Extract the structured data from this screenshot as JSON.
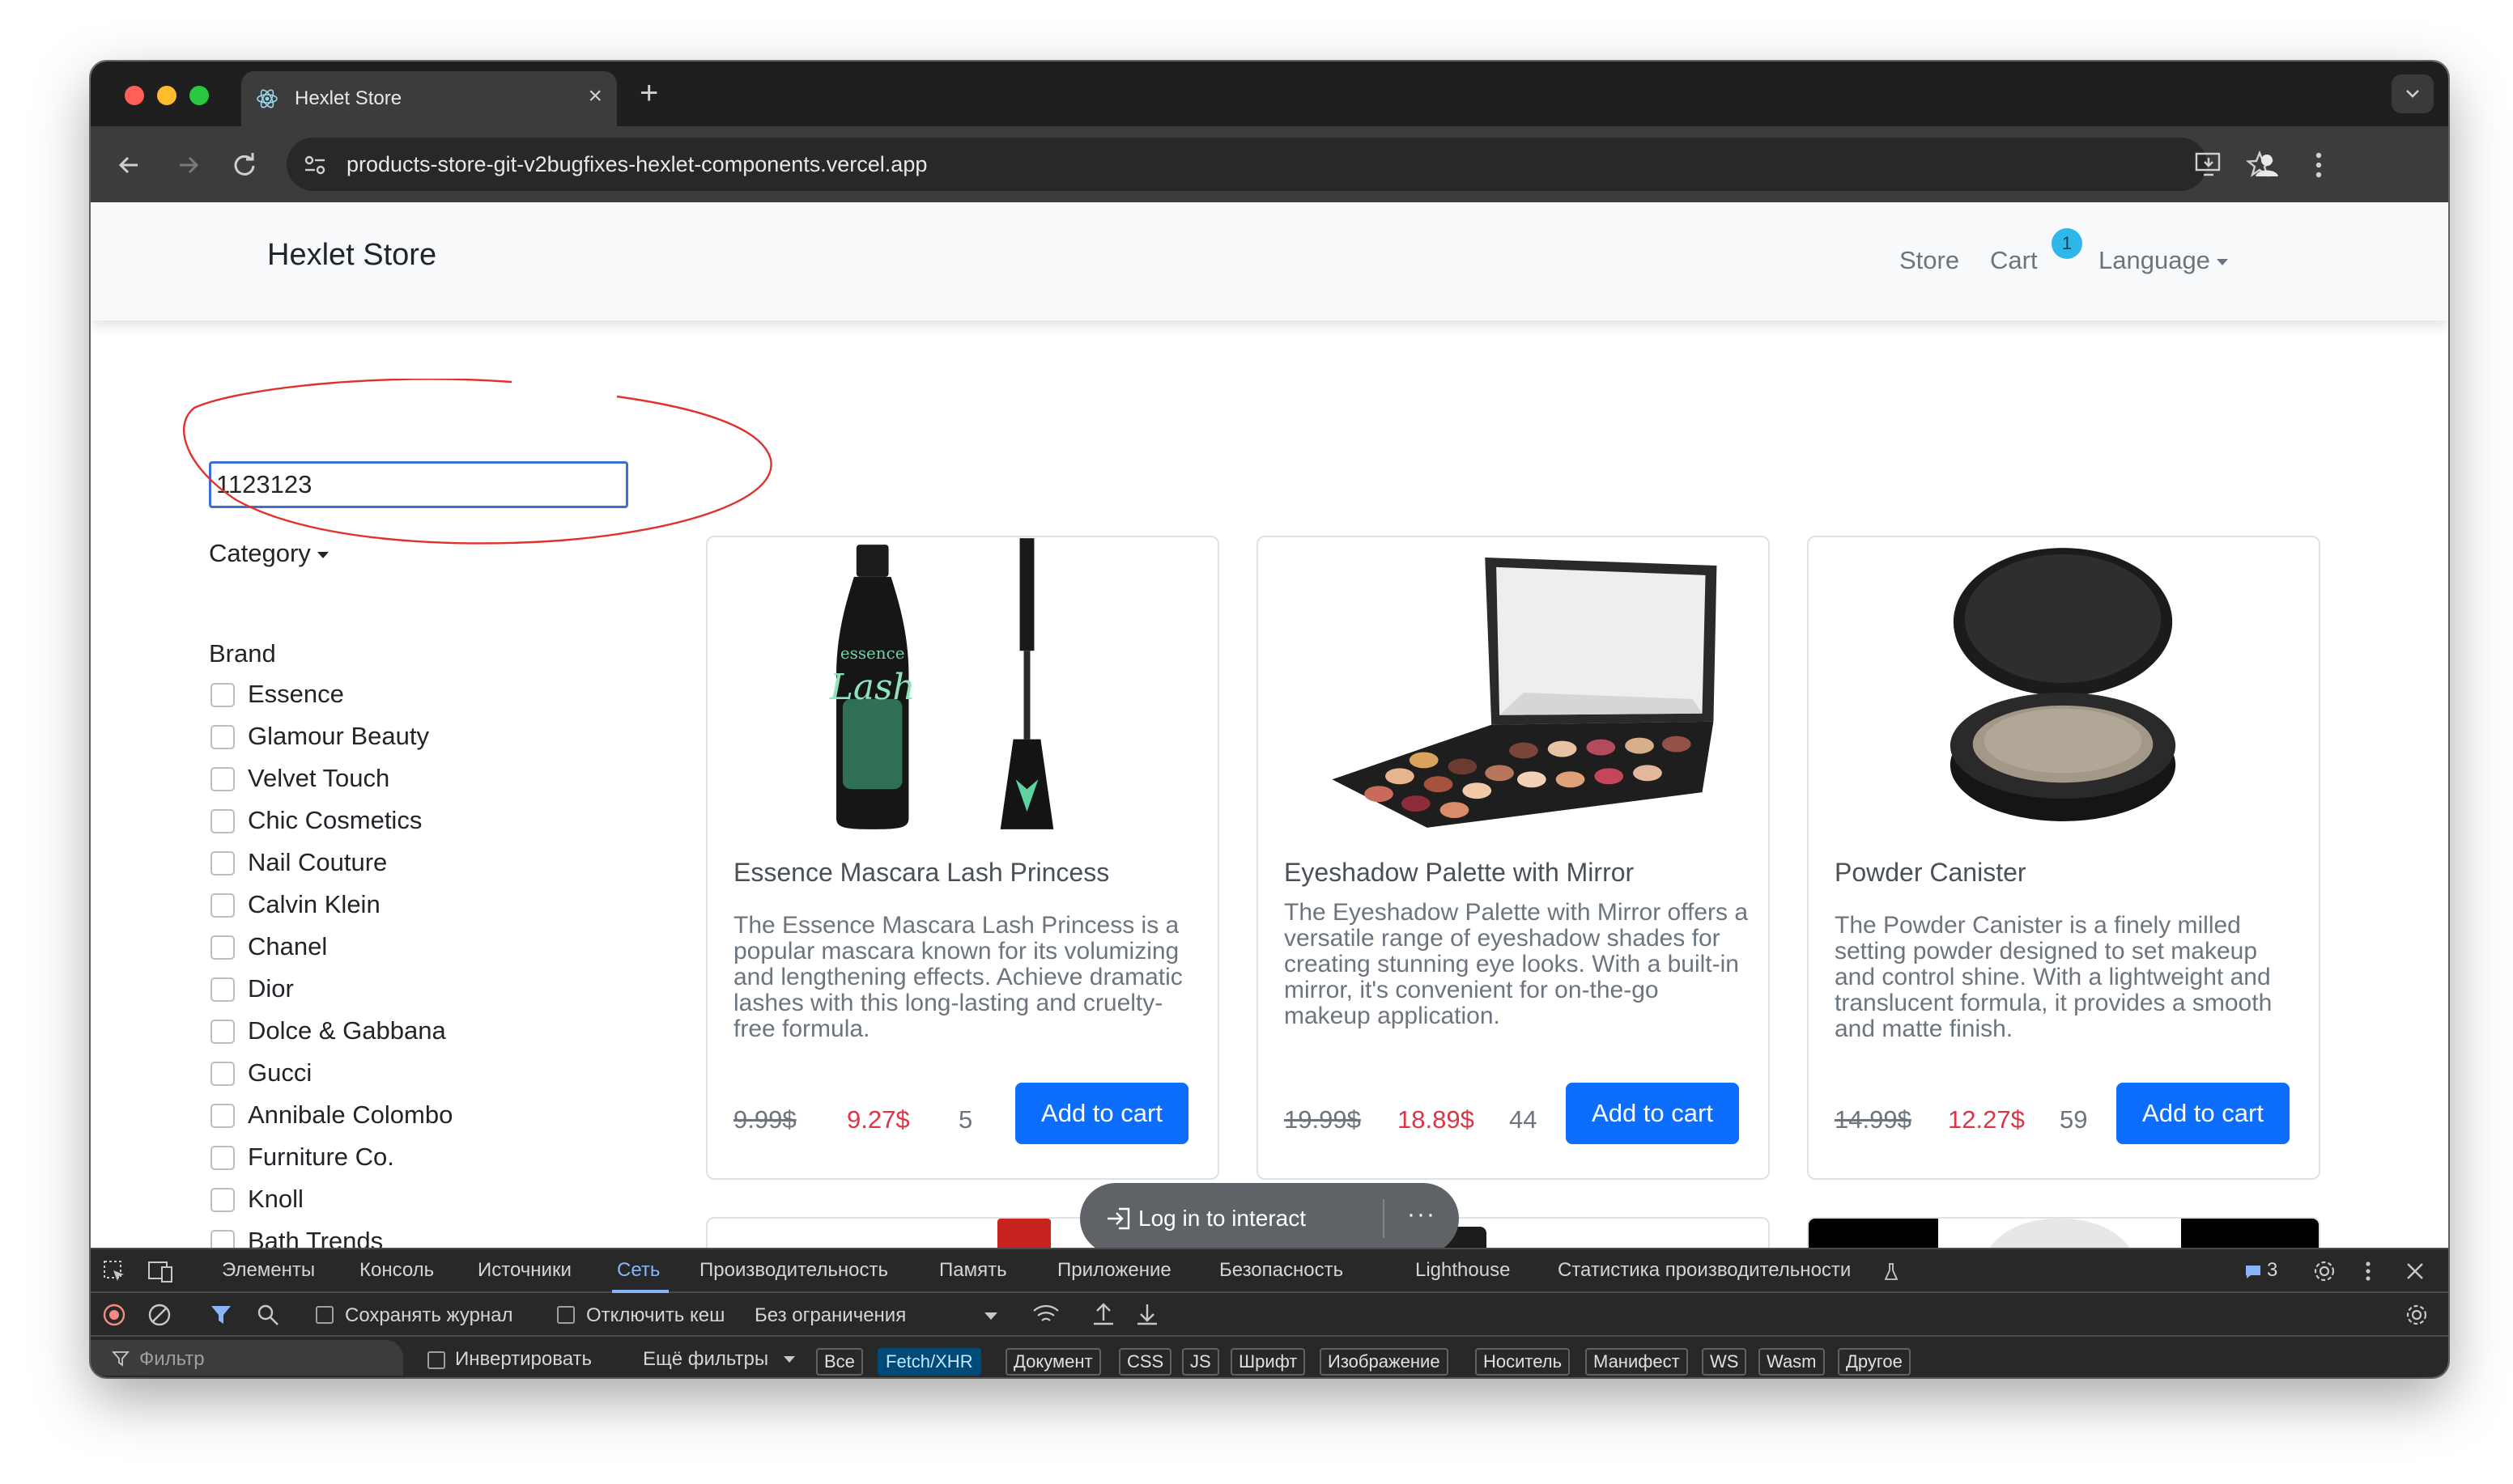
{
  "browser": {
    "tab_title": "Hexlet Store",
    "tab_close": "×",
    "new_tab": "+",
    "url": "products-store-git-v2bugfixes-hexlet-components.vercel.app"
  },
  "navbar": {
    "brand": "Hexlet Store",
    "store_link": "Store",
    "cart_link": "Cart",
    "cart_count": "1",
    "language_link": "Language"
  },
  "search": {
    "value": "1123123"
  },
  "filters": {
    "category_label": "Category",
    "brand_heading": "Brand",
    "brands": [
      "Essence",
      "Glamour Beauty",
      "Velvet Touch",
      "Chic Cosmetics",
      "Nail Couture",
      "Calvin Klein",
      "Chanel",
      "Dior",
      "Dolce & Gabbana",
      "Gucci",
      "Annibale Colombo",
      "Furniture Co.",
      "Knoll",
      "Bath Trends",
      ""
    ]
  },
  "products": [
    {
      "title": "Essence Mascara Lash Princess",
      "description": "The Essence Mascara Lash Princess is a popular mascara known for its volumizing and lengthening effects. Achieve dramatic lashes with this long-lasting and cruelty-free formula.",
      "old_price": "9.99$",
      "price": "9.27$",
      "stock": "5",
      "button": "Add to cart"
    },
    {
      "title": "Eyeshadow Palette with Mirror",
      "description": "The Eyeshadow Palette with Mirror offers a versatile range of eyeshadow shades for creating stunning eye looks. With a built-in mirror, it's convenient for on-the-go makeup application.",
      "old_price": "19.99$",
      "price": "18.89$",
      "stock": "44",
      "button": "Add to cart"
    },
    {
      "title": "Powder Canister",
      "description": "The Powder Canister is a finely milled setting powder designed to set makeup and control shine. With a lightweight and translucent formula, it provides a smooth and matte finish.",
      "old_price": "14.99$",
      "price": "12.27$",
      "stock": "59",
      "button": "Add to cart"
    }
  ],
  "overlay": {
    "login_text": "Log in to interact",
    "more": "···"
  },
  "devtools": {
    "tabs": [
      "Элементы",
      "Консоль",
      "Источники",
      "Сеть",
      "Производительность",
      "Память",
      "Приложение",
      "Безопасность",
      "Lighthouse",
      "Статистика производительности"
    ],
    "active_tab": "Сеть",
    "issues_count": "3",
    "preserve_log": "Сохранять журнал",
    "disable_cache": "Отключить кеш",
    "throttling": "Без ограничения",
    "filter_placeholder": "Фильтр",
    "invert": "Инвертировать",
    "more_filters": "Ещё фильтры",
    "chips": [
      "Все",
      "Fetch/XHR",
      "Документ",
      "CSS",
      "JS",
      "Шрифт",
      "Изображение",
      "Носитель",
      "Манифест",
      "WS",
      "Wasm",
      "Другое"
    ],
    "active_chip": "Fetch/XHR"
  },
  "colors": {
    "primary": "#0d6efd",
    "sale_price": "#dc3545",
    "badge": "#2fb7e9",
    "annotation": "#e0322b",
    "devtools_accent": "#8ab4f8"
  }
}
